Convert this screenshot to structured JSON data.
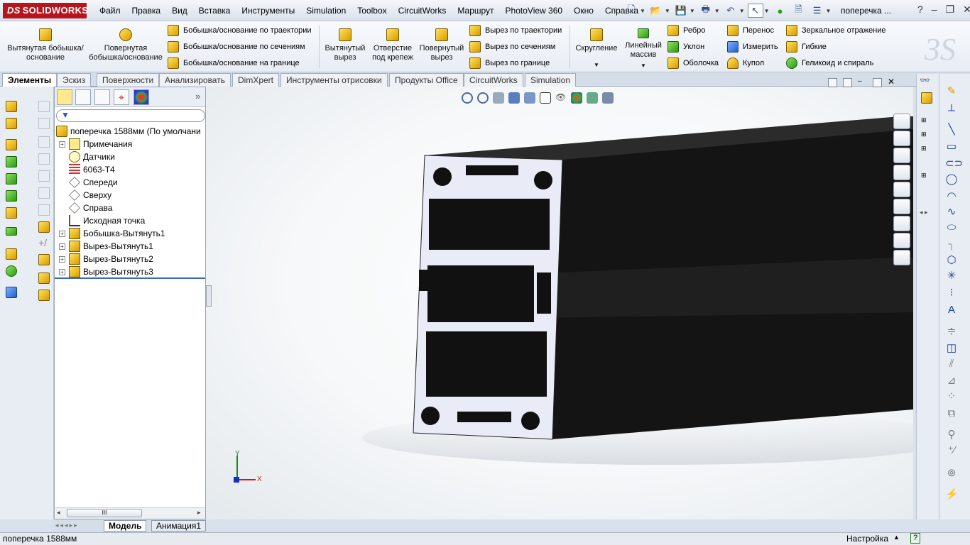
{
  "app": {
    "logo_text": "SOLIDWORKS",
    "logo_prefix": "DS"
  },
  "menu": [
    "Файл",
    "Правка",
    "Вид",
    "Вставка",
    "Инструменты",
    "Simulation",
    "Toolbox",
    "CircuitWorks",
    "Маршрут",
    "PhotoView 360",
    "Окно",
    "Справка"
  ],
  "quick_access": {
    "doc_title": "поперечка ...",
    "help": "?"
  },
  "ribbon": {
    "extrude_boss": "Вытянутая бобышка/основание",
    "revolve_boss": "Повернутая бобышка/основание",
    "sweep_boss": "Бобышка/основание по траектории",
    "loft_boss": "Бобышка/основание по сечениям",
    "boundary_boss": "Бобышка/основание на границе",
    "extrude_cut": "Вытянутый вырез",
    "hole_wizard": "Отверстие под крепеж",
    "revolve_cut": "Повернутый вырез",
    "sweep_cut": "Вырез по траектории",
    "loft_cut": "Вырез по сечениям",
    "boundary_cut": "Вырез по границе",
    "fillet": "Скругление",
    "linear_pattern": "Линейный массив",
    "rib": "Ребро",
    "draft": "Уклон",
    "shell": "Оболочка",
    "move": "Перенос",
    "measure": "Измерить",
    "dome": "Купол",
    "mirror": "Зеркальное отражение",
    "flex": "Гибкие",
    "helix": "Геликоид и спираль"
  },
  "tabs": [
    "Элементы",
    "Эскиз",
    "Поверхности",
    "Анализировать",
    "DimXpert",
    "Инструменты отрисовки",
    "Продукты Office",
    "CircuitWorks",
    "Simulation"
  ],
  "feature_tree": {
    "root": "поперечка 1588мм  (По умолчани",
    "items": [
      {
        "label": "Примечания",
        "expandable": true,
        "icon": "annotations-icon"
      },
      {
        "label": "Датчики",
        "expandable": false,
        "icon": "sensors-icon"
      },
      {
        "label": "6063-T4",
        "expandable": false,
        "icon": "material-icon"
      },
      {
        "label": "Спереди",
        "expandable": false,
        "icon": "plane-icon"
      },
      {
        "label": "Сверху",
        "expandable": false,
        "icon": "plane-icon"
      },
      {
        "label": "Справа",
        "expandable": false,
        "icon": "plane-icon"
      },
      {
        "label": "Исходная точка",
        "expandable": false,
        "icon": "origin-icon"
      },
      {
        "label": "Бобышка-Вытянуть1",
        "expandable": true,
        "icon": "boss-extrude-icon"
      },
      {
        "label": "Вырез-Вытянуть1",
        "expandable": true,
        "icon": "cut-extrude-icon"
      },
      {
        "label": "Вырез-Вытянуть2",
        "expandable": true,
        "icon": "cut-extrude-icon"
      },
      {
        "label": "Вырез-Вытянуть3",
        "expandable": true,
        "icon": "cut-extrude-icon"
      }
    ]
  },
  "scroll_label": "III",
  "bottom_tabs": [
    "Модель",
    "Анимация1"
  ],
  "triad": {
    "y": "Y",
    "x": "X"
  },
  "status": {
    "left": "поперечка 1588мм",
    "right": "Настройка",
    "help": "?"
  },
  "colors": {
    "accent": "#b8141c",
    "ribbon_bg": "#eef2f7",
    "model": "#141414"
  }
}
